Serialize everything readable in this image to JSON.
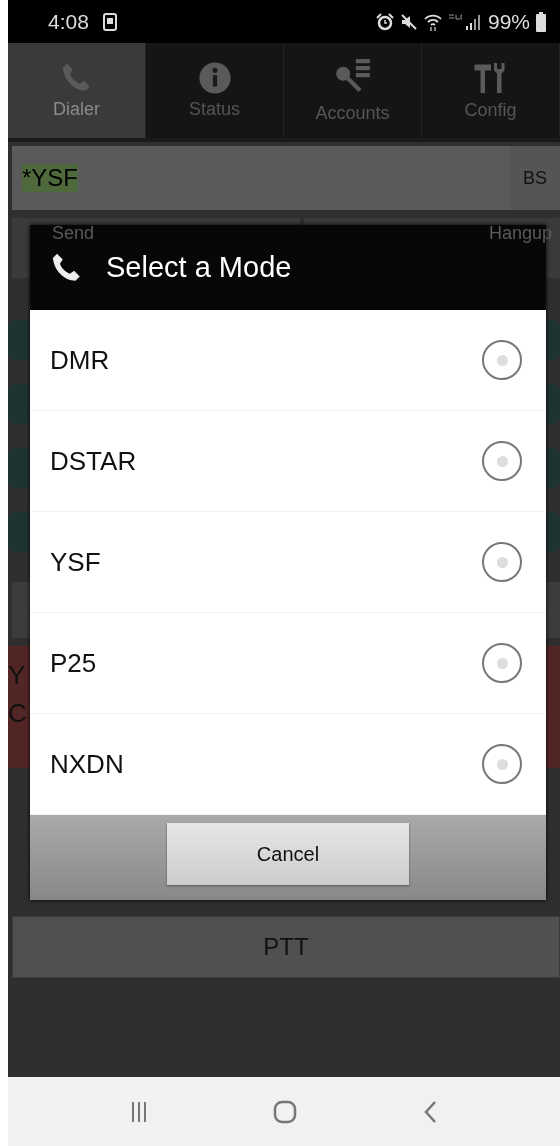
{
  "status_bar": {
    "time": "4:08",
    "battery": "99%"
  },
  "tabs": [
    {
      "label": "Dialer",
      "selected": true
    },
    {
      "label": "Status",
      "selected": false
    },
    {
      "label": "Accounts",
      "selected": false
    },
    {
      "label": "Config",
      "selected": false
    }
  ],
  "dial_field": {
    "value": "*YSF",
    "backspace": "BS"
  },
  "call_buttons": [
    "Send",
    "Hangup"
  ],
  "log_panel": {
    "lines": [
      "Y",
      "C"
    ]
  },
  "dialog": {
    "title": "Select a Mode",
    "options": [
      {
        "label": "DMR",
        "selected": false
      },
      {
        "label": "DSTAR",
        "selected": false
      },
      {
        "label": "YSF",
        "selected": false
      },
      {
        "label": "P25",
        "selected": false
      },
      {
        "label": "NXDN",
        "selected": false
      }
    ],
    "cancel": "Cancel"
  },
  "ptt": "PTT"
}
